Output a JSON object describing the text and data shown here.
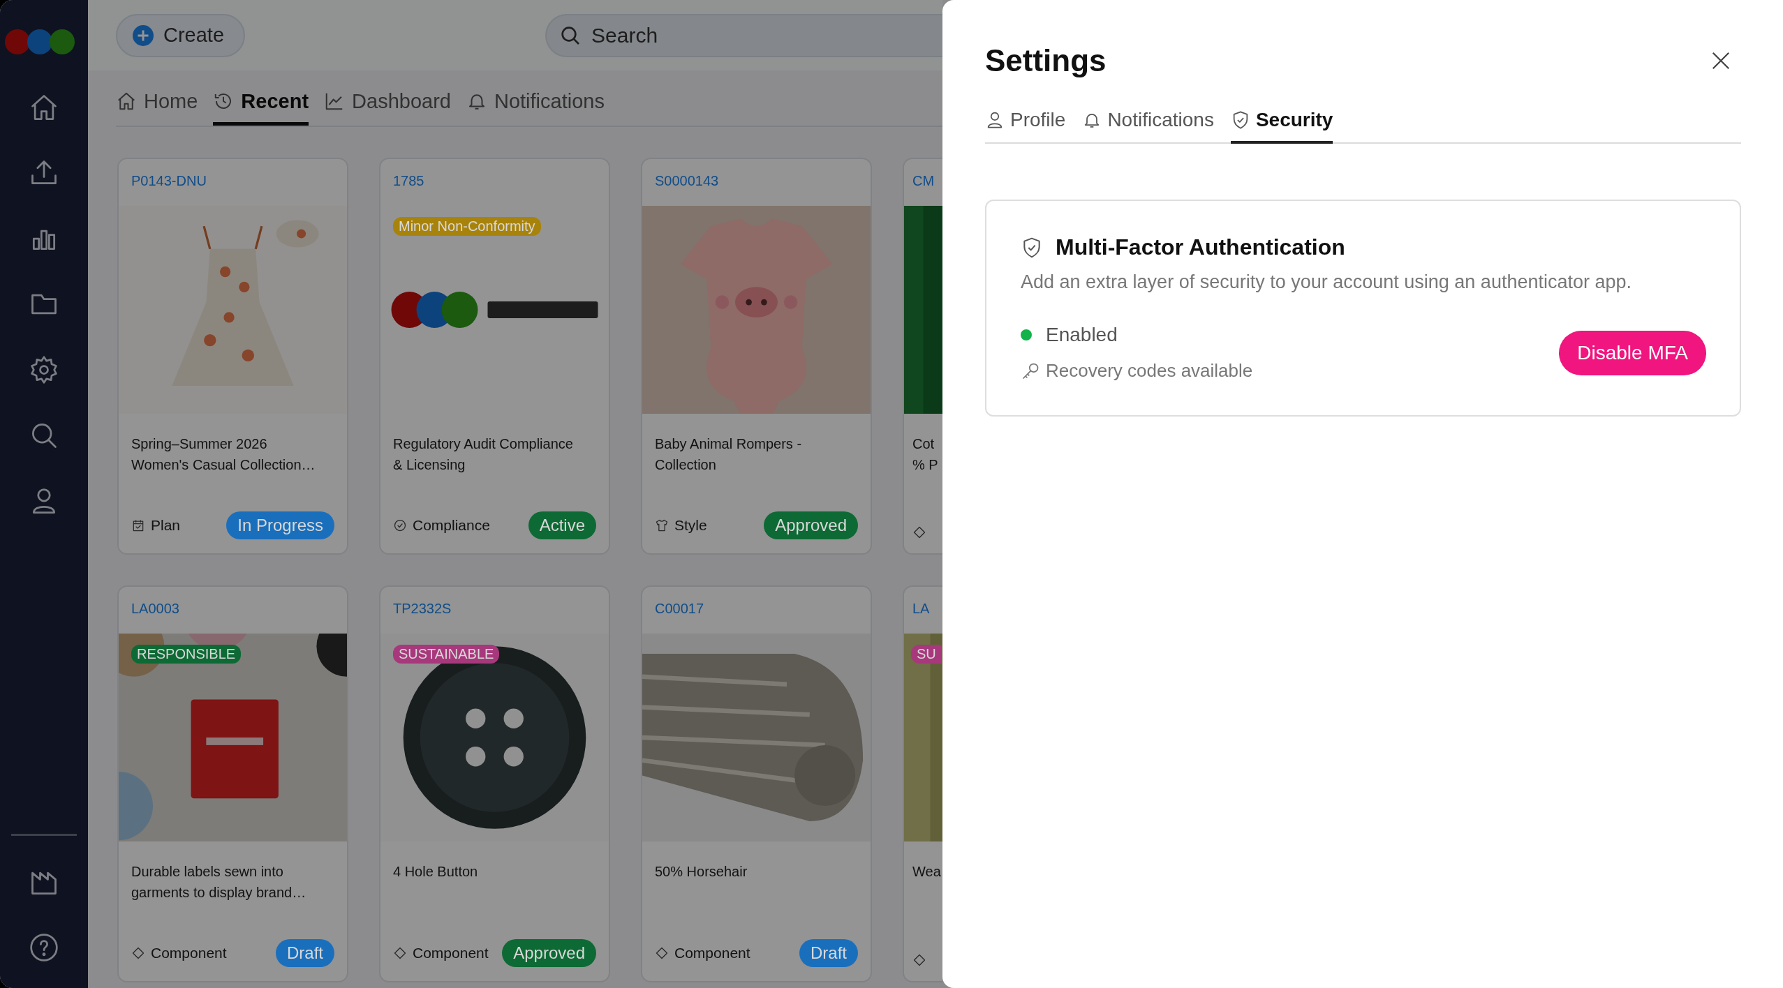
{
  "topbar": {
    "create_button": "Create",
    "search": {
      "placeholder": "Search"
    }
  },
  "tabs": [
    {
      "label": "Home",
      "selected": false
    },
    {
      "label": "Recent",
      "selected": true
    },
    {
      "label": "Dashboard",
      "selected": false
    },
    {
      "label": "Notifications",
      "selected": false
    }
  ],
  "cards": [
    {
      "code": "P0143-DNU",
      "title": "Spring–Summer 2026 Women's Casual Collection…",
      "kind": "plan",
      "type": "Plan",
      "status": {
        "label": "In Progress",
        "color": "#1a6fbd"
      }
    },
    {
      "code": "1785",
      "tag": {
        "label": "Minor Non-Conformity",
        "color": "#a8830c"
      },
      "title": "Regulatory Audit Compliance & Licensing",
      "kind": "compliance",
      "type": "Compliance",
      "status": {
        "label": "Active",
        "color": "#0d6a34"
      }
    },
    {
      "code": "S0000143",
      "title": "Baby Animal Rompers - Collection",
      "kind": "style",
      "type": "Style",
      "status": {
        "label": "Approved",
        "color": "#0d6a34"
      }
    },
    {
      "code": "CM",
      "title": "Cot\n% P",
      "kind": "component"
    },
    {
      "code": "LA0003",
      "tag": {
        "label": "RESPONSIBLE",
        "color": "#0d6a34"
      },
      "title": "Durable labels sewn into garments to display brand…",
      "kind": "component",
      "type": "Component",
      "status": {
        "label": "Draft",
        "color": "#1a6fbd"
      }
    },
    {
      "code": "TP2332S",
      "tag": {
        "label": "SUSTAINABLE",
        "color": "#a8387c"
      },
      "title": "4 Hole Button",
      "kind": "component",
      "type": "Component",
      "status": {
        "label": "Approved",
        "color": "#0d6a34"
      }
    },
    {
      "code": "C00017",
      "title": "50% Horsehair",
      "kind": "component",
      "type": "Component",
      "status": {
        "label": "Draft",
        "color": "#1a6fbd"
      }
    },
    {
      "code": "LA",
      "tag": {
        "label": "SU",
        "color": "#a8387c"
      },
      "title": "Wea",
      "kind": "component"
    }
  ],
  "settings": {
    "title": "Settings",
    "tabs": [
      {
        "label": "Profile",
        "selected": false
      },
      {
        "label": "Notifications",
        "selected": false
      },
      {
        "label": "Security",
        "selected": true
      }
    ],
    "mfa": {
      "title": "Multi-Factor Authentication",
      "description": "Add an extra layer of security to your account using an authenticator app.",
      "enabled": true,
      "status": "Enabled",
      "recovery": "Recovery codes available",
      "button": "Disable MFA"
    }
  }
}
